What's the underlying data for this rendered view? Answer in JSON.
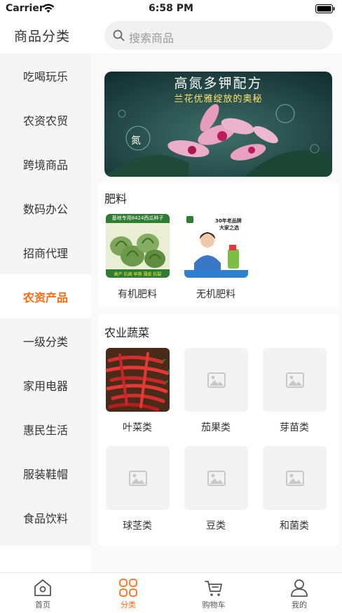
{
  "status_bar": {
    "carrier": "Carrier",
    "time": "6:58 PM"
  },
  "header": {
    "title": "商品分类",
    "search_placeholder": "搜索商品"
  },
  "sidebar": {
    "active_index": 5,
    "items": [
      {
        "label": "吃喝玩乐"
      },
      {
        "label": "农资农贸"
      },
      {
        "label": "跨境商品"
      },
      {
        "label": "数码办公"
      },
      {
        "label": "招商代理"
      },
      {
        "label": "农资产品"
      },
      {
        "label": "一级分类"
      },
      {
        "label": "家用电器"
      },
      {
        "label": "惠民生活"
      },
      {
        "label": "服装鞋帽"
      },
      {
        "label": "食品饮料"
      }
    ]
  },
  "banner": {
    "title": "高氮多钾配方",
    "subtitle": "兰花优雅绽放的奥秘",
    "bubble_text": "氮"
  },
  "sections": [
    {
      "title": "肥料",
      "items": [
        {
          "label": "有机肥料",
          "image": "watermelon-seed-photo",
          "image_caption_top": "基地专用8424西瓜种子",
          "image_caption_bottom": "高产 抗病 早熟 薄皮 抗裂"
        },
        {
          "label": "无机肥料",
          "image": "fertilizer-ad-photo",
          "image_caption_top": "30年老品牌",
          "image_caption_sub": "大家之选"
        }
      ]
    },
    {
      "title": "农业蔬菜",
      "items": [
        {
          "label": "叶菜类",
          "image": "red-chili-photo"
        },
        {
          "label": "茄果类",
          "image": "image-placeholder-icon"
        },
        {
          "label": "芽苗类",
          "image": "image-placeholder-icon"
        },
        {
          "label": "球茎类",
          "image": "image-placeholder-icon"
        },
        {
          "label": "豆类",
          "image": "image-placeholder-icon"
        },
        {
          "label": "和菌类",
          "image": "image-placeholder-icon"
        }
      ]
    }
  ],
  "tabbar": {
    "active_index": 1,
    "tabs": [
      {
        "label": "首页",
        "icon": "home-icon"
      },
      {
        "label": "分类",
        "icon": "category-grid-icon"
      },
      {
        "label": "购物车",
        "icon": "cart-icon"
      },
      {
        "label": "我的",
        "icon": "user-icon"
      }
    ]
  },
  "colors": {
    "accent": "#ff6b12",
    "sidebar_bg": "#f5f5f5",
    "search_bg": "#f1f1f1"
  }
}
